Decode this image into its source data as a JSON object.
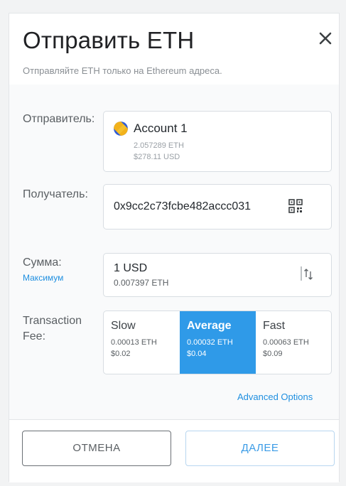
{
  "dialog": {
    "title": "Отправить ETH",
    "subtitle": "Отправляйте ETH только на Ethereum адреса."
  },
  "form": {
    "sender_label": "Отправитель:",
    "recipient_label": "Получатель:",
    "amount_label": "Сумма:",
    "max_link": "Максимум",
    "fee_label_line1": "Transaction",
    "fee_label_line2": "Fee:",
    "advanced_link": "Advanced Options"
  },
  "account": {
    "name": "Account 1",
    "balance_eth": "2.057289 ETH",
    "balance_usd": "$278.11 USD"
  },
  "recipient": {
    "address": "0x9cc2c73fcbe482accc031"
  },
  "amount": {
    "value": "1  USD",
    "converted": "0.007397 ETH"
  },
  "fees": [
    {
      "name": "Slow",
      "eth": "0.00013 ETH",
      "usd": "$0.02",
      "selected": false
    },
    {
      "name": "Average",
      "eth": "0.00032 ETH",
      "usd": "$0.04",
      "selected": true
    },
    {
      "name": "Fast",
      "eth": "0.00063 ETH",
      "usd": "$0.09",
      "selected": false
    }
  ],
  "footer": {
    "cancel_label": "ОТМЕНА",
    "next_label": "ДАЛЕЕ"
  },
  "icons": {
    "close": "close-icon",
    "account": "account-identicon",
    "qr": "qr-code-icon",
    "swap": "swap-currency-icon"
  },
  "colors": {
    "accent": "#2f9ae8",
    "link": "#1f8fe0"
  }
}
